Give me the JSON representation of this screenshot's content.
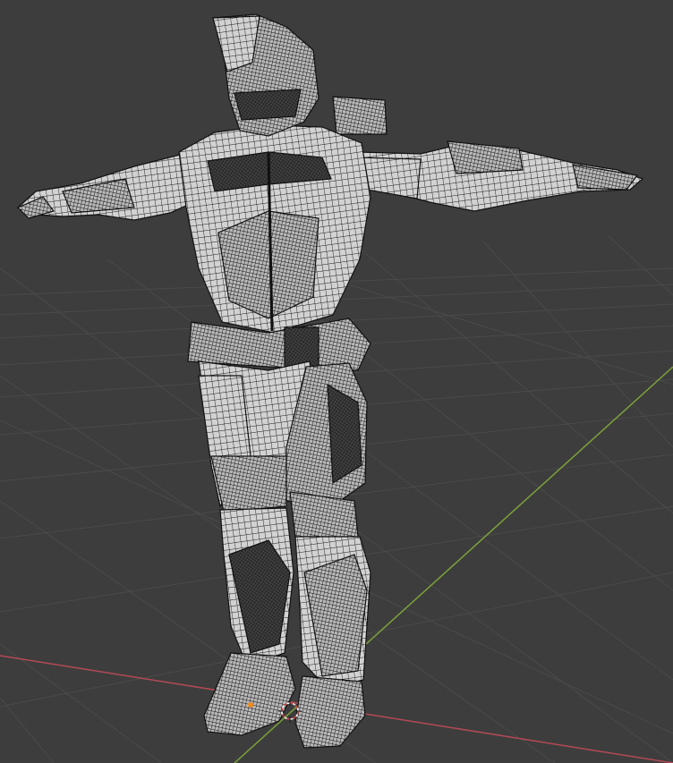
{
  "viewport": {
    "background_color": "#3d3d3d",
    "grid_line_color": "#4a4a4a",
    "x_axis_color": "#b34a55",
    "y_axis_color": "#7ea23a",
    "wire_color": "#1b1b1b",
    "surface_color": "#d2d2d2",
    "origin_marker_color": "#f28a1e",
    "cursor_color": "#d04040"
  },
  "scene": {
    "object_icon": "armored-character-mesh-icon",
    "cursor_icon": "3d-cursor-icon",
    "origin_icon": "object-origin-dot-icon"
  }
}
